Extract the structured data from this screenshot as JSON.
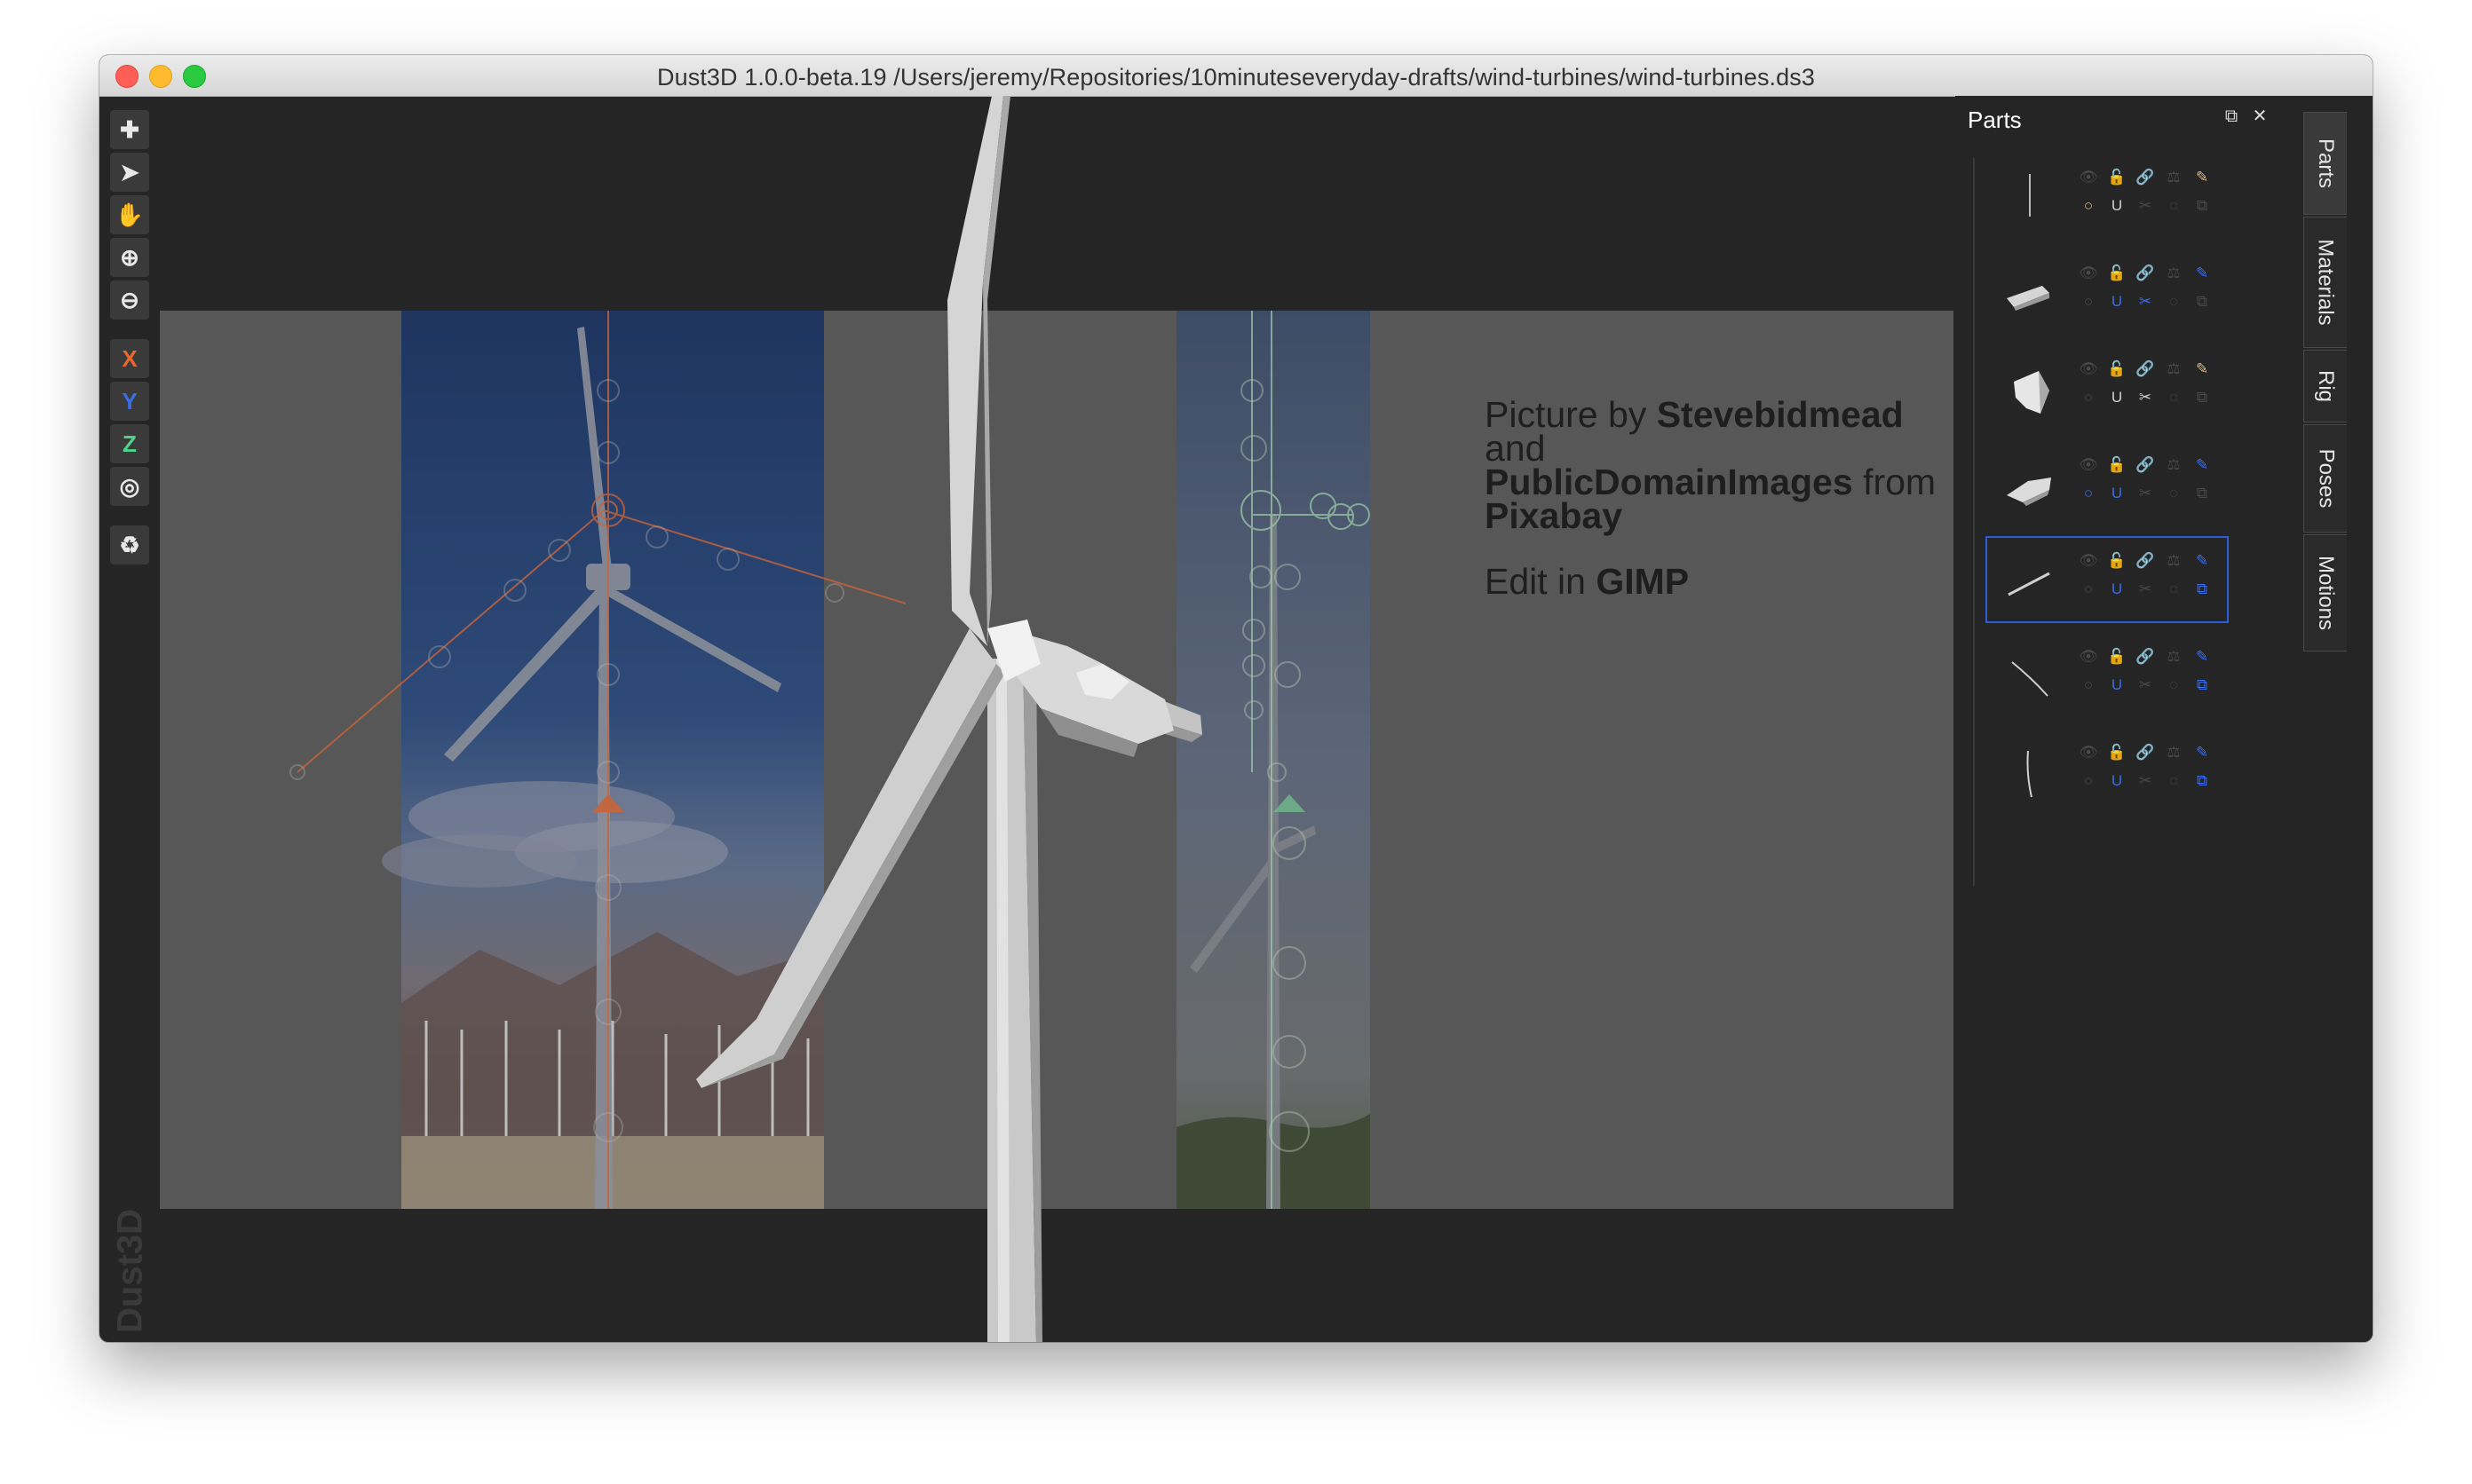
{
  "window": {
    "title": "Dust3D 1.0.0-beta.19 /Users/jeremy/Repositories/10minuteseveryday-drafts/wind-turbines/wind-turbines.ds3"
  },
  "toolbar": {
    "items": [
      {
        "name": "add",
        "glyph": "✚"
      },
      {
        "name": "select",
        "glyph": "➤"
      },
      {
        "name": "pan",
        "glyph": "✋"
      },
      {
        "name": "zoom-in",
        "glyph": "⊕"
      },
      {
        "name": "zoom-out",
        "glyph": "⊖"
      },
      {
        "name": "x-axis",
        "glyph": "X",
        "color": "#e8672e"
      },
      {
        "name": "y-axis",
        "glyph": "Y",
        "color": "#3a6ee8"
      },
      {
        "name": "z-axis",
        "glyph": "Z",
        "color": "#4fd38a"
      },
      {
        "name": "radius",
        "glyph": "◎"
      },
      {
        "name": "recycle",
        "glyph": "♻"
      }
    ]
  },
  "watermark": "Dust3D",
  "reference": {
    "line1_prefix": "Picture by ",
    "line1_bold": "Stevebidmead",
    "line1_suffix": " and",
    "line2_bold": "PublicDomainImages",
    "line2_suffix": " from",
    "line3_bold": "Pixabay",
    "line4_prefix": "Edit in ",
    "line4_bold": "GIMP"
  },
  "parts_panel": {
    "title": "Parts",
    "parts": [
      {
        "thumb": "thin-line",
        "selected": false
      },
      {
        "thumb": "small-box",
        "selected": false
      },
      {
        "thumb": "nacelle",
        "selected": false
      },
      {
        "thumb": "hub",
        "selected": false
      },
      {
        "thumb": "blade",
        "selected": true
      },
      {
        "thumb": "curve",
        "selected": false
      },
      {
        "thumb": "vertical-line",
        "selected": false
      }
    ]
  },
  "side_tabs": [
    "Parts",
    "Materials",
    "Rig",
    "Poses",
    "Motions"
  ],
  "colors": {
    "accent": "#3a6ee8",
    "x_axis": "#e8672e",
    "z_axis": "#4fd38a",
    "background": "#252525"
  }
}
